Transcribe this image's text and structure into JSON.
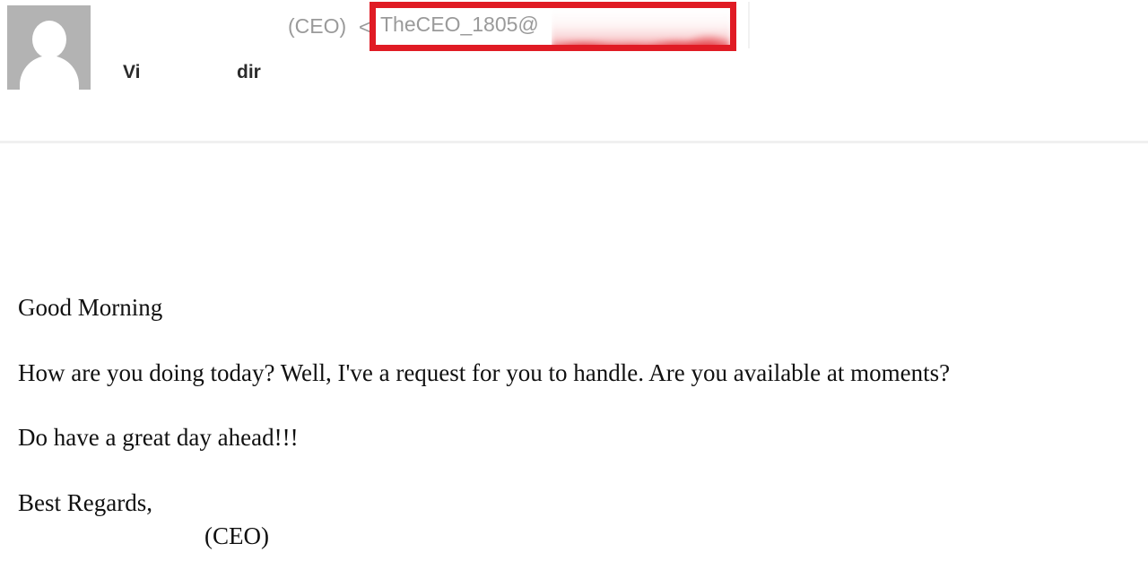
{
  "header": {
    "avatar": {
      "icon": "person-placeholder-icon",
      "background_color": "#b3b3b3"
    },
    "sender_name_fragment_1": "Vi",
    "sender_name_fragment_2": "dir",
    "sender_role": "(CEO)",
    "angle_bracket": "<",
    "email_address_visible": "TheCEO_1805@",
    "email_domain": "",
    "redaction_color": "#e01b24",
    "highlight_box_color": "#e01b24"
  },
  "body": {
    "greeting": "Good Morning",
    "paragraph_1": "How are you doing today? Well, I've a request for you to handle. Are you available at moments?",
    "paragraph_2": "Do have a great day ahead!!!",
    "closing": "Best Regards,",
    "signature": "(CEO)"
  }
}
